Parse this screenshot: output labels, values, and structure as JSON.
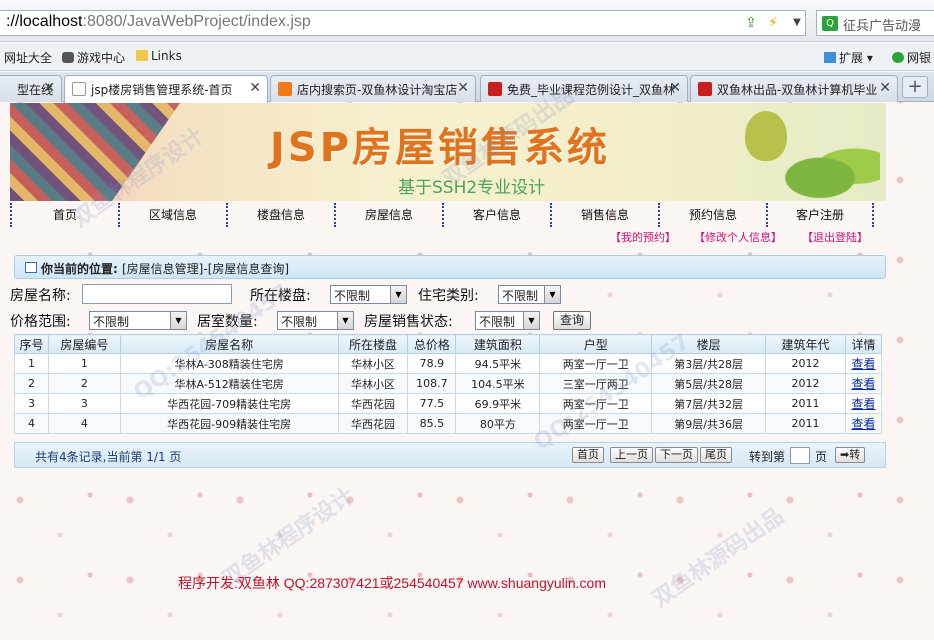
{
  "browser": {
    "url_host": "localhost",
    "url_path": ":8080/JavaWebProject/index.jsp",
    "search_placeholder": "征兵广告动漫",
    "bookmarks": [
      "网址大全",
      "游戏中心",
      "Links"
    ],
    "extensions_label": "扩展",
    "netbank_label": "网银",
    "tabs": [
      {
        "label": "型在线",
        "color": "#888888"
      },
      {
        "label": "jsp楼房销售管理系统-首页",
        "color": "#ffffff"
      },
      {
        "label": "店内搜索页-双鱼林设计淘宝店",
        "color": "#f07a1a"
      },
      {
        "label": "免费_毕业课程范例设计_双鱼林",
        "color": "#c81e1e"
      },
      {
        "label": "双鱼林出品-双鱼林计算机毕业",
        "color": "#c81e1e"
      }
    ]
  },
  "banner": {
    "title": "JSP房屋销售系统",
    "subtitle": "基于SSH2专业设计"
  },
  "nav": {
    "items": [
      "首页",
      "区域信息",
      "楼盘信息",
      "房屋信息",
      "客户信息",
      "销售信息",
      "预约信息",
      "客户注册"
    ],
    "sub_links": [
      "【我的预约】",
      "【修改个人信息】",
      "【退出登陆】"
    ]
  },
  "position": {
    "label": "你当前的位置:",
    "value": "[房屋信息管理]-[房屋信息查询]"
  },
  "form": {
    "house_name_label": "房屋名称:",
    "house_name_value": "",
    "estate_label": "所在楼盘:",
    "estate_value": "不限制",
    "type_label": "住宅类别:",
    "type_value": "不限制",
    "price_label": "价格范围:",
    "price_value": "不限制",
    "rooms_label": "居室数量:",
    "rooms_value": "不限制",
    "status_label": "房屋销售状态:",
    "status_value": "不限制",
    "query_label": "查询"
  },
  "table": {
    "headers": [
      "序号",
      "房屋编号",
      "房屋名称",
      "所在楼盘",
      "总价格",
      "建筑面积",
      "户型",
      "楼层",
      "建筑年代",
      "详情"
    ],
    "rows": [
      [
        "1",
        "1",
        "华林A-308精装住宅房",
        "华林小区",
        "78.9",
        "94.5平米",
        "两室一厅一卫",
        "第3层/共28层",
        "2012",
        "查看"
      ],
      [
        "2",
        "2",
        "华林A-512精装住宅房",
        "华林小区",
        "108.7",
        "104.5平米",
        "三室一厅两卫",
        "第5层/共28层",
        "2012",
        "查看"
      ],
      [
        "3",
        "3",
        "华西花园-709精装住宅房",
        "华西花园",
        "77.5",
        "69.9平米",
        "两室一厅一卫",
        "第7层/共32层",
        "2011",
        "查看"
      ],
      [
        "4",
        "4",
        "华西花园-909精装住宅房",
        "华西花园",
        "85.5",
        "80平方",
        "两室一厅一卫",
        "第9层/共36层",
        "2011",
        "查看"
      ]
    ]
  },
  "pager": {
    "info": "共有4条记录,当前第 1/1 页",
    "first": "首页",
    "prev": "上一页",
    "next": "下一页",
    "last": "尾页",
    "goto_label": "转到第",
    "goto_value": "",
    "page_unit": "页",
    "go": "➡转"
  },
  "footer": {
    "text": "程序开发:双鱼林 QQ:287307421或254540457 www.shuangyulin.com"
  },
  "watermarks": [
    "双鱼林程序设计",
    "QQ:254540457",
    "双鱼林源码出品",
    "QQ:254540457",
    "双鱼林程序设计",
    "双鱼林源码出品"
  ]
}
